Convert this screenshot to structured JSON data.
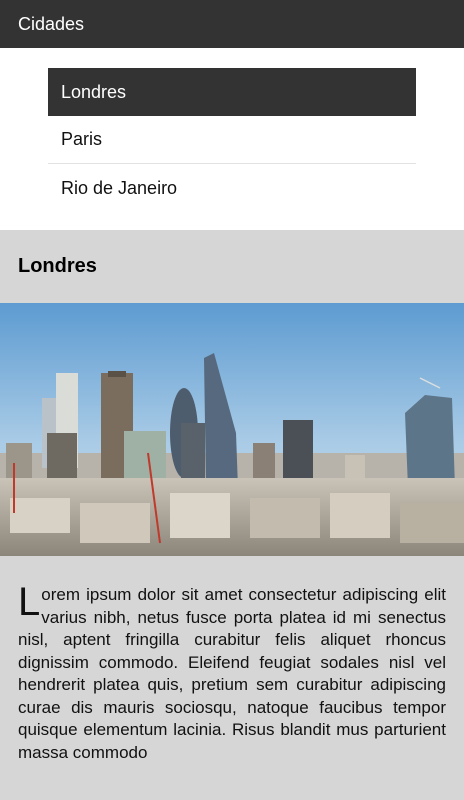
{
  "app_bar": {
    "title": "Cidades"
  },
  "cities": [
    {
      "label": "Londres",
      "selected": true
    },
    {
      "label": "Paris",
      "selected": false
    },
    {
      "label": "Rio de Janeiro",
      "selected": false
    }
  ],
  "detail": {
    "title": "Londres",
    "photo_subject": "london-skyline-photo",
    "drop_cap": "L",
    "text": "orem ipsum dolor sit amet consectetur adipiscing elit varius nibh, netus fusce porta platea id mi senectus nisl, aptent fringilla curabitur felis aliquet rhoncus dignissim commodo. Eleifend feugiat sodales nisl vel hendrerit platea quis, pretium sem curabitur adipiscing curae dis mauris sociosqu, natoque faucibus tempor quisque elementum lacinia. Risus blandit mus parturient massa commodo"
  },
  "colors": {
    "app_bar": "#333333",
    "selected_item": "#333333",
    "detail_bg": "#d6d6d6"
  }
}
